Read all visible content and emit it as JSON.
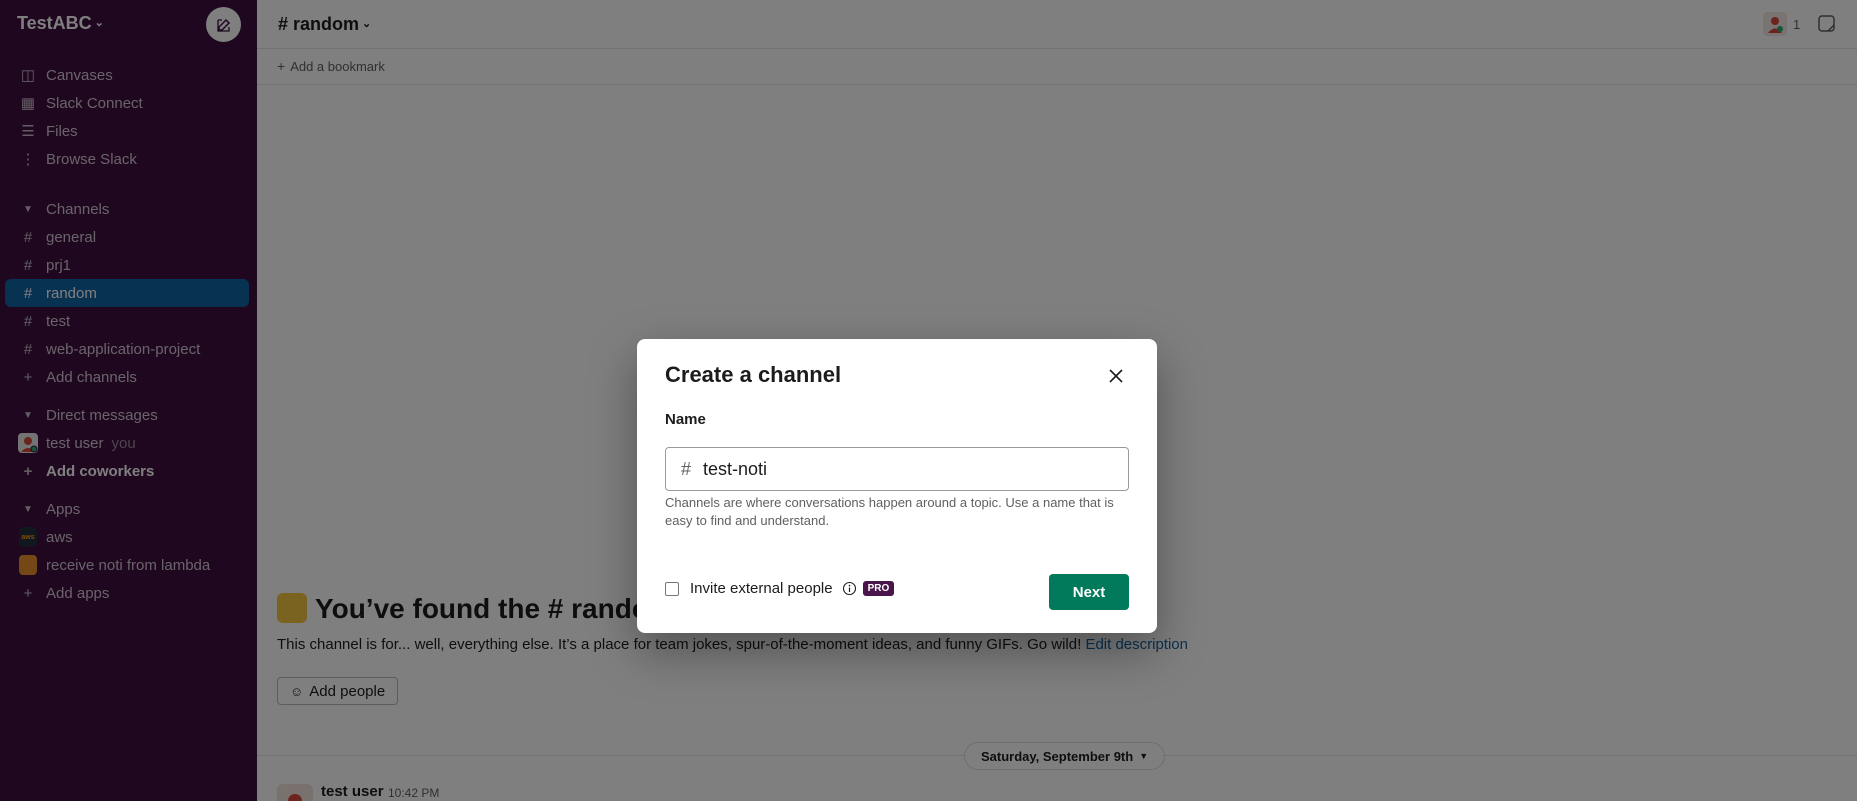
{
  "workspace": {
    "name": "TestABC"
  },
  "sidebar": {
    "nav": [
      {
        "label": "Canvases",
        "icon": "canvas-icon"
      },
      {
        "label": "Slack Connect",
        "icon": "building-icon"
      },
      {
        "label": "Files",
        "icon": "files-icon"
      },
      {
        "label": "Browse Slack",
        "icon": "more-vertical-icon"
      }
    ],
    "channels_header": "Channels",
    "channels": [
      {
        "label": "general"
      },
      {
        "label": "prj1"
      },
      {
        "label": "random",
        "active": true
      },
      {
        "label": "test"
      },
      {
        "label": "web-application-project"
      }
    ],
    "add_channels": "Add channels",
    "dm_header": "Direct messages",
    "dms": [
      {
        "label": "test user",
        "suffix": "you"
      }
    ],
    "add_coworkers": "Add coworkers",
    "apps_header": "Apps",
    "apps": [
      {
        "label": "aws",
        "badge": "aws"
      },
      {
        "label": "receive noti from lambda"
      }
    ],
    "add_apps": "Add apps"
  },
  "header": {
    "channel_title": "# random",
    "member_count": "1",
    "add_bookmark": "Add a bookmark"
  },
  "intro": {
    "title": "You’ve found the # rando",
    "description": "This channel is for... well, everything else. It’s a place for team jokes, spur-of-the-moment ideas, and funny GIFs. Go wild!",
    "edit_link": "Edit description",
    "add_people": "Add people"
  },
  "messages": {
    "date_divider": "Saturday, September 9th",
    "first": {
      "user": "test user",
      "time": "10:42 PM"
    }
  },
  "modal": {
    "title": "Create a channel",
    "name_label": "Name",
    "name_prefix": "#",
    "name_value": "test-noti",
    "hint": "Channels are where conversations happen around a topic. Use a name that is easy to find and understand.",
    "invite_label": "Invite external people",
    "pro_badge": "PRO",
    "next_label": "Next",
    "invite_checked": false
  },
  "colors": {
    "sidebar_bg": "#3f0e40",
    "active_item": "#1164a3",
    "primary_button": "#007a5a",
    "link": "#1264a3"
  }
}
